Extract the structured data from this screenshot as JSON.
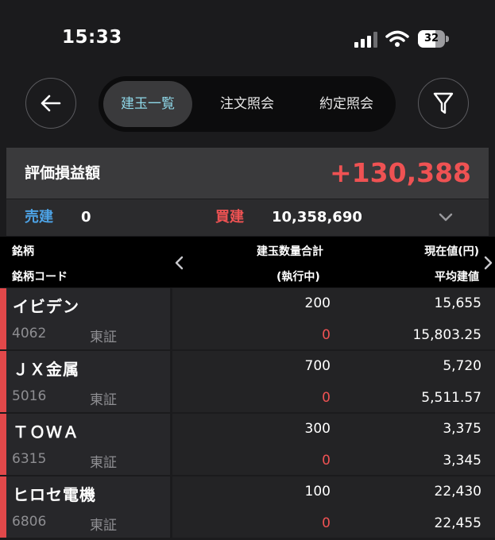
{
  "status_bar": {
    "time": "15:33",
    "battery": "32"
  },
  "nav": {
    "tabs": [
      {
        "label": "建玉一覧",
        "active": true
      },
      {
        "label": "注文照会",
        "active": false
      },
      {
        "label": "約定照会",
        "active": false
      }
    ]
  },
  "summary": {
    "pl_label": "評価損益額",
    "pl_value": "+130,388",
    "sell_label": "売建",
    "sell_value": "0",
    "buy_label": "買建",
    "buy_value": "10,358,690"
  },
  "table_header": {
    "name": "銘柄",
    "code": "銘柄コード",
    "qty_total": "建玉数量合計",
    "executing": "(執行中)",
    "current_price": "現在値(円)",
    "avg_price": "平均建値"
  },
  "positions": [
    {
      "name": "イビデン",
      "code": "4062",
      "market": "東証",
      "qty": "200",
      "pending": "0",
      "price": "15,655",
      "avg": "15,803.25"
    },
    {
      "name": "ＪＸ金属",
      "code": "5016",
      "market": "東証",
      "qty": "700",
      "pending": "0",
      "price": "5,720",
      "avg": "5,511.57"
    },
    {
      "name": "ＴＯＷＡ",
      "code": "6315",
      "market": "東証",
      "qty": "300",
      "pending": "0",
      "price": "3,375",
      "avg": "3,345"
    },
    {
      "name": "ヒロセ電機",
      "code": "6806",
      "market": "東証",
      "qty": "100",
      "pending": "0",
      "price": "22,430",
      "avg": "22,455"
    }
  ],
  "colors": {
    "accent": "#ef5253",
    "active_tab_text": "#8fd8e9",
    "sell": "#4da3e6",
    "buy": "#ef5253"
  }
}
